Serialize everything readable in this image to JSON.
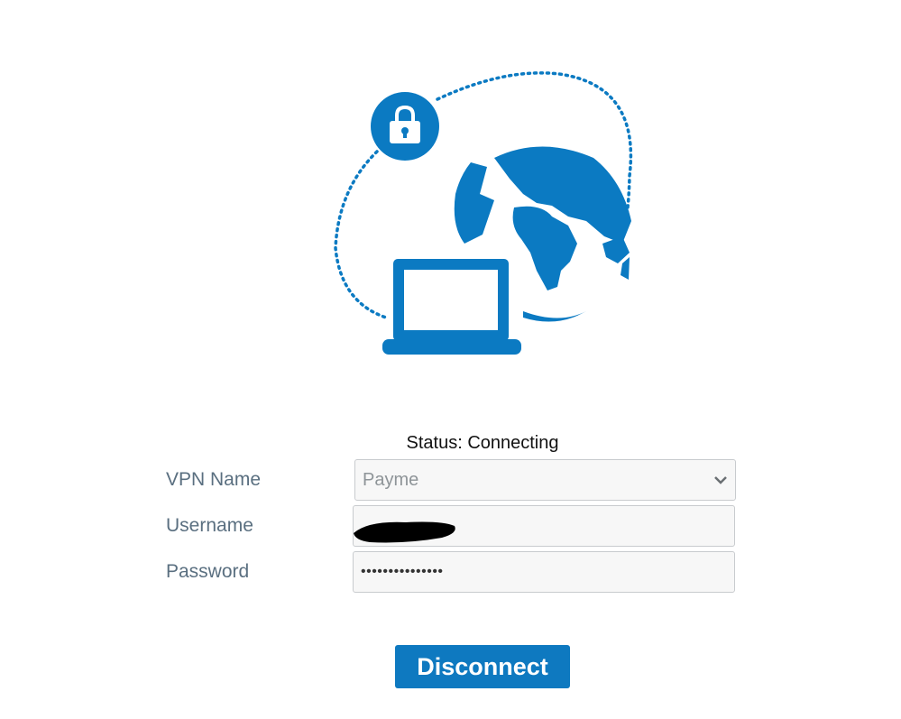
{
  "colors": {
    "brand_blue": "#0b7ac2",
    "label_gray": "#5a6f80",
    "field_background": "#f7f7f7",
    "field_border": "#c8cbce",
    "button_blue": "#0e79c0"
  },
  "illustration": {
    "icons": [
      "lock-icon",
      "globe-icon",
      "laptop-icon"
    ]
  },
  "status": {
    "text": "Status: Connecting"
  },
  "form": {
    "vpn_name_label": "VPN Name",
    "vpn_name_value": "Payme",
    "username_label": "Username",
    "username_value": "",
    "password_label": "Password",
    "password_value": "•••••••••••••••"
  },
  "actions": {
    "disconnect_label": "Disconnect"
  }
}
